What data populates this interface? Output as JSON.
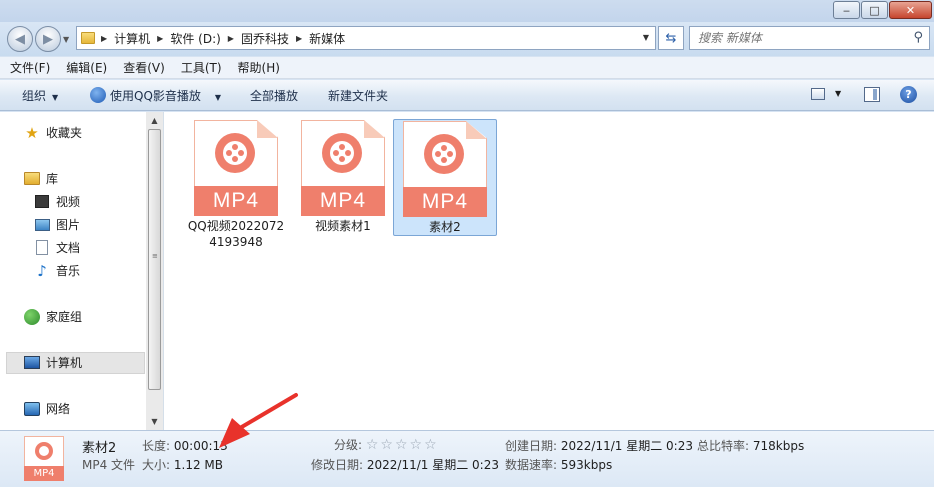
{
  "window": {
    "minimize": "‒",
    "maximize": "□",
    "close": "✕"
  },
  "nav": {
    "breadcrumbs": [
      "计算机",
      "软件 (D:)",
      "固乔科技",
      "新媒体"
    ],
    "search_placeholder": "搜索 新媒体"
  },
  "menu": [
    "文件(F)",
    "编辑(E)",
    "查看(V)",
    "工具(T)",
    "帮助(H)"
  ],
  "commands": {
    "organize": "组织",
    "play_qq": "使用QQ影音播放",
    "play_all": "全部播放",
    "new_folder": "新建文件夹"
  },
  "sidebar": {
    "favorites": "收藏夹",
    "libraries": "库",
    "lib_items": [
      "视频",
      "图片",
      "文档",
      "音乐"
    ],
    "homegroup": "家庭组",
    "computer": "计算机",
    "network": "网络"
  },
  "files": [
    {
      "badge": "MP4",
      "name": "QQ视频20220724193948",
      "selected": false
    },
    {
      "badge": "MP4",
      "name": "视频素材1",
      "selected": false
    },
    {
      "badge": "MP4",
      "name": "素材2",
      "selected": true
    }
  ],
  "details": {
    "badge": "MP4",
    "name": "素材2",
    "type": "MP4 文件",
    "length_label": "长度:",
    "length": "00:00:13",
    "size_label": "大小:",
    "size": "1.12 MB",
    "rating_label": "分级:",
    "rating_stars": "☆☆☆☆☆",
    "modified_label": "修改日期:",
    "modified": "2022/11/1 星期二 0:23",
    "created_label": "创建日期:",
    "created": "2022/11/1 星期二 0:23",
    "bitrate_label": "总比特率:",
    "bitrate": "718kbps",
    "datarate_label": "数据速率:",
    "datarate": "593kbps"
  },
  "colors": {
    "accent": "#ef7f6c",
    "selection": "#cce4fb",
    "annotation_arrow": "#e8322b"
  }
}
